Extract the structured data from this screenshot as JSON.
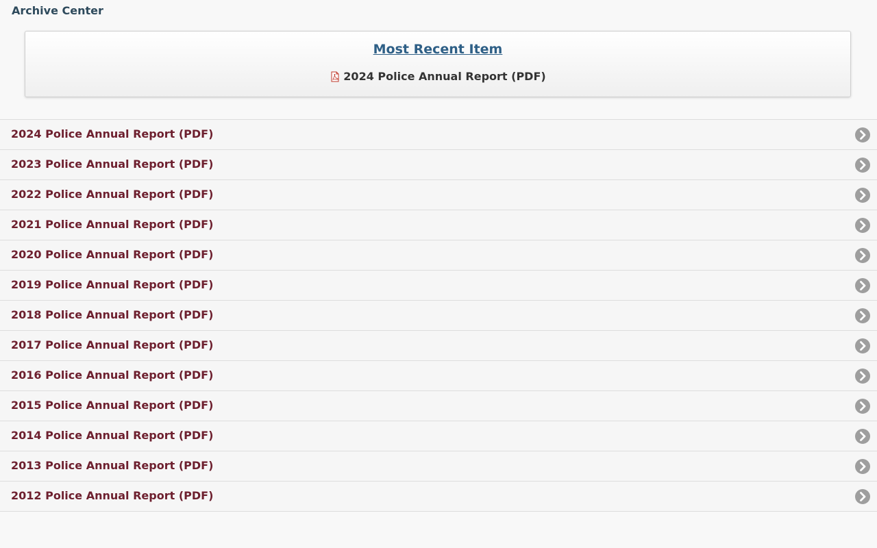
{
  "page": {
    "title": "Archive Center"
  },
  "recent": {
    "heading": "Most Recent Item",
    "item_label": "2024 Police Annual Report (PDF)",
    "icon": "pdf-icon"
  },
  "archive_items": [
    {
      "label": "2024 Police Annual Report (PDF)"
    },
    {
      "label": "2023 Police Annual Report (PDF)"
    },
    {
      "label": "2022 Police Annual Report (PDF)"
    },
    {
      "label": "2021 Police Annual Report (PDF)"
    },
    {
      "label": "2020 Police Annual Report (PDF)"
    },
    {
      "label": "2019 Police Annual Report (PDF)"
    },
    {
      "label": "2018 Police Annual Report (PDF)"
    },
    {
      "label": "2017 Police Annual Report (PDF)"
    },
    {
      "label": "2016 Police Annual Report (PDF)"
    },
    {
      "label": "2015 Police Annual Report (PDF)"
    },
    {
      "label": "2014 Police Annual Report (PDF)"
    },
    {
      "label": "2013 Police Annual Report (PDF)"
    },
    {
      "label": "2012 Police Annual Report (PDF)"
    }
  ],
  "colors": {
    "item_text": "#6d1f2e",
    "heading_link": "#2e5f86",
    "title": "#2e4a5c",
    "arrow": "#9e9e9e"
  },
  "icons": {
    "row_arrow": "chevron-right-circle-icon"
  }
}
